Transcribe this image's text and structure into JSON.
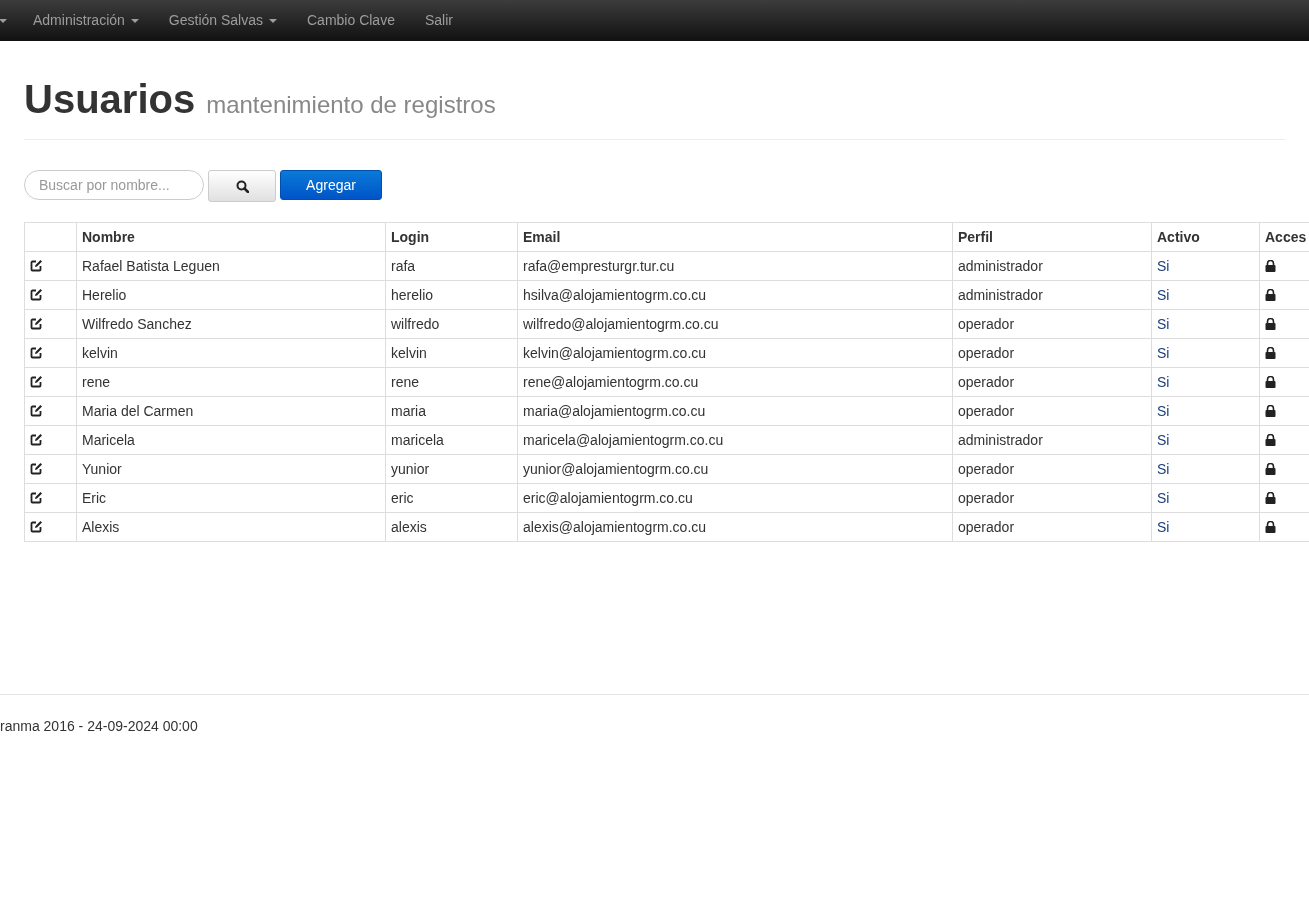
{
  "navbar": {
    "items": [
      {
        "label": "Administración",
        "dropdown": true
      },
      {
        "label": "Gestión Salvas",
        "dropdown": true
      },
      {
        "label": "Cambio Clave",
        "dropdown": false
      },
      {
        "label": "Salir",
        "dropdown": false
      }
    ]
  },
  "header": {
    "title": "Usuarios",
    "subtitle": "mantenimiento de registros"
  },
  "search": {
    "placeholder": "Buscar por nombre..."
  },
  "add_button": "Agregar",
  "table": {
    "columns": [
      "Nombre",
      "Login",
      "Email",
      "Perfil",
      "Activo",
      "Acces"
    ],
    "rows": [
      {
        "nombre": "Rafael Batista Leguen",
        "login": "rafa",
        "email": "rafa@empresturgr.tur.cu",
        "perfil": "administrador",
        "activo": "Si"
      },
      {
        "nombre": "Herelio",
        "login": "herelio",
        "email": "hsilva@alojamientogrm.co.cu",
        "perfil": "administrador",
        "activo": "Si"
      },
      {
        "nombre": "Wilfredo Sanchez",
        "login": "wilfredo",
        "email": "wilfredo@alojamientogrm.co.cu",
        "perfil": "operador",
        "activo": "Si"
      },
      {
        "nombre": "kelvin",
        "login": "kelvin",
        "email": "kelvin@alojamientogrm.co.cu",
        "perfil": "operador",
        "activo": "Si"
      },
      {
        "nombre": "rene",
        "login": "rene",
        "email": "rene@alojamientogrm.co.cu",
        "perfil": "operador",
        "activo": "Si"
      },
      {
        "nombre": "Maria del Carmen",
        "login": "maria",
        "email": "maria@alojamientogrm.co.cu",
        "perfil": "operador",
        "activo": "Si"
      },
      {
        "nombre": "Maricela",
        "login": "maricela",
        "email": "maricela@alojamientogrm.co.cu",
        "perfil": "administrador",
        "activo": "Si"
      },
      {
        "nombre": "Yunior",
        "login": "yunior",
        "email": "yunior@alojamientogrm.co.cu",
        "perfil": "operador",
        "activo": "Si"
      },
      {
        "nombre": "Eric",
        "login": "eric",
        "email": "eric@alojamientogrm.co.cu",
        "perfil": "operador",
        "activo": "Si"
      },
      {
        "nombre": "Alexis",
        "login": "alexis",
        "email": "alexis@alojamientogrm.co.cu",
        "perfil": "operador",
        "activo": "Si"
      }
    ]
  },
  "footer": "ranma 2016 - 24-09-2024 00:00"
}
